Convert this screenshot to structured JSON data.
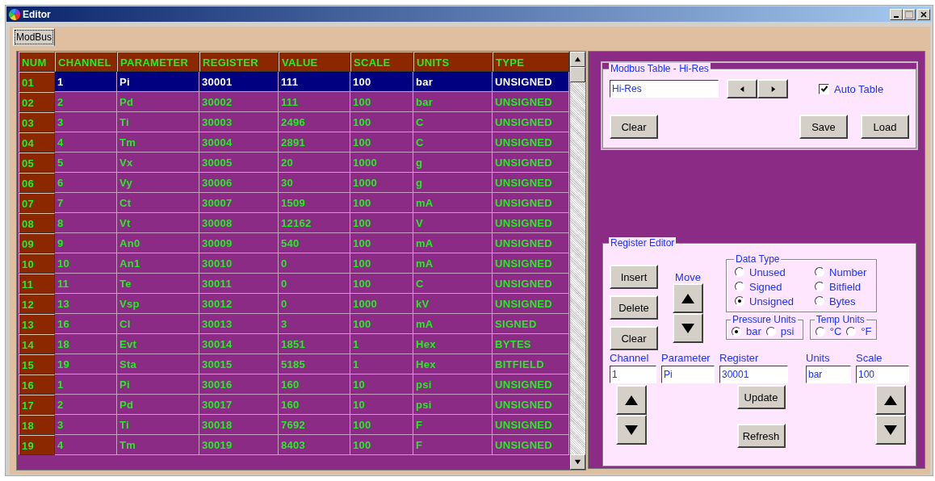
{
  "window": {
    "title": "Editor"
  },
  "tabs": [
    {
      "label": "ModBus",
      "selected": true
    }
  ],
  "table": {
    "columns": [
      "NUM",
      "CHANNEL",
      "PARAMETER",
      "REGISTER",
      "VALUE",
      "SCALE",
      "UNITS",
      "TYPE"
    ],
    "rows": [
      {
        "cells": [
          "01",
          "1",
          "Pi",
          "30001",
          "111",
          "100",
          "bar",
          "UNSIGNED"
        ],
        "selected": true
      },
      {
        "cells": [
          "02",
          "2",
          "Pd",
          "30002",
          "111",
          "100",
          "bar",
          "UNSIGNED"
        ],
        "selected": false
      },
      {
        "cells": [
          "03",
          "3",
          "Ti",
          "30003",
          "2496",
          "100",
          "C",
          "UNSIGNED"
        ],
        "selected": false
      },
      {
        "cells": [
          "04",
          "4",
          "Tm",
          "30004",
          "2891",
          "100",
          "C",
          "UNSIGNED"
        ],
        "selected": false
      },
      {
        "cells": [
          "05",
          "5",
          "Vx",
          "30005",
          "20",
          "1000",
          "g",
          "UNSIGNED"
        ],
        "selected": false
      },
      {
        "cells": [
          "06",
          "6",
          "Vy",
          "30006",
          "30",
          "1000",
          "g",
          "UNSIGNED"
        ],
        "selected": false
      },
      {
        "cells": [
          "07",
          "7",
          "Ct",
          "30007",
          "1509",
          "100",
          "mA",
          "UNSIGNED"
        ],
        "selected": false
      },
      {
        "cells": [
          "08",
          "8",
          "Vt",
          "30008",
          "12162",
          "100",
          "V",
          "UNSIGNED"
        ],
        "selected": false
      },
      {
        "cells": [
          "09",
          "9",
          "An0",
          "30009",
          "540",
          "100",
          "mA",
          "UNSIGNED"
        ],
        "selected": false
      },
      {
        "cells": [
          "10",
          "10",
          "An1",
          "30010",
          "0",
          "100",
          "mA",
          "UNSIGNED"
        ],
        "selected": false
      },
      {
        "cells": [
          "11",
          "11",
          "Te",
          "30011",
          "0",
          "100",
          "C",
          "UNSIGNED"
        ],
        "selected": false
      },
      {
        "cells": [
          "12",
          "13",
          "Vsp",
          "30012",
          "0",
          "1000",
          "kV",
          "UNSIGNED"
        ],
        "selected": false
      },
      {
        "cells": [
          "13",
          "16",
          "Cl",
          "30013",
          "3",
          "100",
          "mA",
          "SIGNED"
        ],
        "selected": false
      },
      {
        "cells": [
          "14",
          "18",
          "Evt",
          "30014",
          "1851",
          "1",
          "Hex",
          "BYTES"
        ],
        "selected": false
      },
      {
        "cells": [
          "15",
          "19",
          "Sta",
          "30015",
          "5185",
          "1",
          "Hex",
          "BITFIELD"
        ],
        "selected": false
      },
      {
        "cells": [
          "16",
          "1",
          "Pi",
          "30016",
          "160",
          "10",
          "psi",
          "UNSIGNED"
        ],
        "selected": false
      },
      {
        "cells": [
          "17",
          "2",
          "Pd",
          "30017",
          "160",
          "10",
          "psi",
          "UNSIGNED"
        ],
        "selected": false
      },
      {
        "cells": [
          "18",
          "3",
          "Ti",
          "30018",
          "7692",
          "100",
          "F",
          "UNSIGNED"
        ],
        "selected": false
      },
      {
        "cells": [
          "19",
          "4",
          "Tm",
          "30019",
          "8403",
          "100",
          "F",
          "UNSIGNED"
        ],
        "selected": false
      }
    ]
  },
  "modbus_table": {
    "title": "Modbus Table -  Hi-Res",
    "name_field": "Hi-Res",
    "auto_table": {
      "label": "Auto Table",
      "checked": true
    },
    "buttons": [
      "Clear",
      "Save",
      "Load"
    ]
  },
  "register_editor": {
    "title": "Register Editor",
    "buttons": [
      "Insert",
      "Delete",
      "Clear"
    ],
    "move_label": "Move",
    "data_type": {
      "title": "Data Type",
      "options": [
        {
          "label": "Unused",
          "selected": false
        },
        {
          "label": "Signed",
          "selected": false
        },
        {
          "label": "Unsigned",
          "selected": true
        },
        {
          "label": "Number",
          "selected": false
        },
        {
          "label": "Bitfield",
          "selected": false
        },
        {
          "label": "Bytes",
          "selected": false
        }
      ]
    },
    "pressure_units": {
      "title": "Pressure Units",
      "options": [
        {
          "label": "bar",
          "selected": true
        },
        {
          "label": "psi",
          "selected": false
        }
      ]
    },
    "temp_units": {
      "title": "Temp Units",
      "options": [
        {
          "label": "°C",
          "selected": false
        },
        {
          "label": "°F",
          "selected": false
        }
      ]
    },
    "fields": [
      {
        "label": "Channel",
        "value": "1"
      },
      {
        "label": "Parameter",
        "value": "Pi"
      },
      {
        "label": "Register",
        "value": "30001"
      },
      {
        "label": "Units",
        "value": "bar"
      },
      {
        "label": "Scale",
        "value": "100"
      }
    ],
    "update_button": "Update",
    "refresh_button": "Refresh"
  }
}
